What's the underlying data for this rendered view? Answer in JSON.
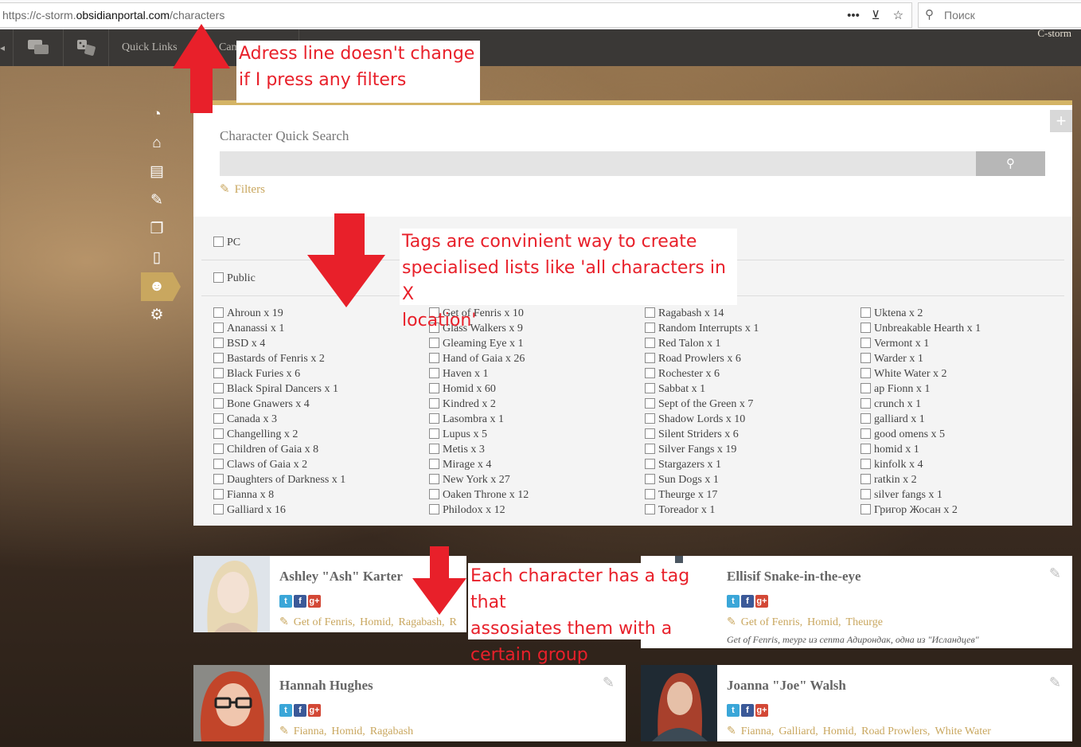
{
  "browser": {
    "url_prefix": "https://c-storm.",
    "url_domain": "obsidianportal.com",
    "url_path": "/characters",
    "search_placeholder": "Поиск",
    "more_icon": "•••",
    "pocket_icon": "⊻",
    "star_icon": "☆",
    "search_icon": "⚲"
  },
  "nav": {
    "quick_links": "Quick Links",
    "campaign_fragment": "Cam",
    "campaign_name": "C-storm"
  },
  "panel": {
    "title": "Character Quick Search",
    "plus": "+",
    "filters_label": "Filters"
  },
  "filters": {
    "pc_label": "PC",
    "public_label": "Public",
    "tags_col1": [
      "Ahroun x 19",
      "Ananassi x 1",
      "BSD x 4",
      "Bastards of Fenris x 2",
      "Black Furies x 6",
      "Black Spiral Dancers x 1",
      "Bone Gnawers x 4",
      "Canada x 3",
      "Changelling x 2",
      "Children of Gaia x 8",
      "Claws of Gaia x 2",
      "Daughters of Darkness x 1",
      "Fianna x 8",
      "Galliard x 16"
    ],
    "tags_col2": [
      "Get of Fenris x 10",
      "Glass Walkers x 9",
      "Gleaming Eye x 1",
      "Hand of Gaia x 26",
      "Haven x 1",
      "Homid x 60",
      "Kindred x 2",
      "Lasombra x 1",
      "Lupus x 5",
      "Metis x 3",
      "Mirage x 4",
      "New York x 27",
      "Oaken Throne x 12",
      "Philodox x 12"
    ],
    "tags_col3": [
      "Ragabash x 14",
      "Random Interrupts x 1",
      "Red Talon x 1",
      "Road Prowlers x 6",
      "Rochester x 6",
      "Sabbat x 1",
      "Sept of the Green x 7",
      "Shadow Lords x 10",
      "Silent Striders x 6",
      "Silver Fangs x 19",
      "Stargazers x 1",
      "Sun Dogs x 1",
      "Theurge x 17",
      "Toreador x 1"
    ],
    "tags_col4": [
      "Uktena x 2",
      "Unbreakable Hearth x 1",
      "Vermont x 1",
      "Warder x 1",
      "White Water x 2",
      "ap Fionn x 1",
      "crunch x 1",
      "galliard x 1",
      "good omens x 5",
      "homid x 1",
      "kinfolk x 4",
      "ratkin x 2",
      "silver fangs x 1",
      "Григор Жосан x 2"
    ]
  },
  "characters": {
    "ashley": {
      "name": "Ashley \"Ash\" Karter",
      "tags": [
        "Get of Fenris,",
        "Homid,",
        "Ragabash,",
        "R"
      ]
    },
    "ellisif": {
      "name": "Ellisif Snake-in-the-eye",
      "tags": [
        "Get of Fenris,",
        "Homid,",
        "Theurge"
      ],
      "desc": "Get of Fenris, теург из септа Адирондак, одна из \"Исландцев\""
    },
    "hannah": {
      "name": "Hannah Hughes",
      "tags": [
        "Fianna,",
        "Homid,",
        "Ragabash"
      ]
    },
    "joanna": {
      "name": "Joanna \"Joe\" Walsh",
      "tags": [
        "Fianna,",
        "Galliard,",
        "Homid,",
        "Road Prowlers,",
        "White Water"
      ]
    }
  },
  "annotations": {
    "address": [
      "Adress line doesn't change",
      "if I press any filters"
    ],
    "tags": [
      "Tags are convinient way to create",
      "specialised lists like 'all characters in X",
      "location'"
    ],
    "character": [
      "Each character has a tag that",
      "assosiates them with a",
      "certain group"
    ]
  },
  "colors": {
    "accent": "#c9a75f",
    "annotation": "#e8202a",
    "nav": "#3a3836"
  }
}
